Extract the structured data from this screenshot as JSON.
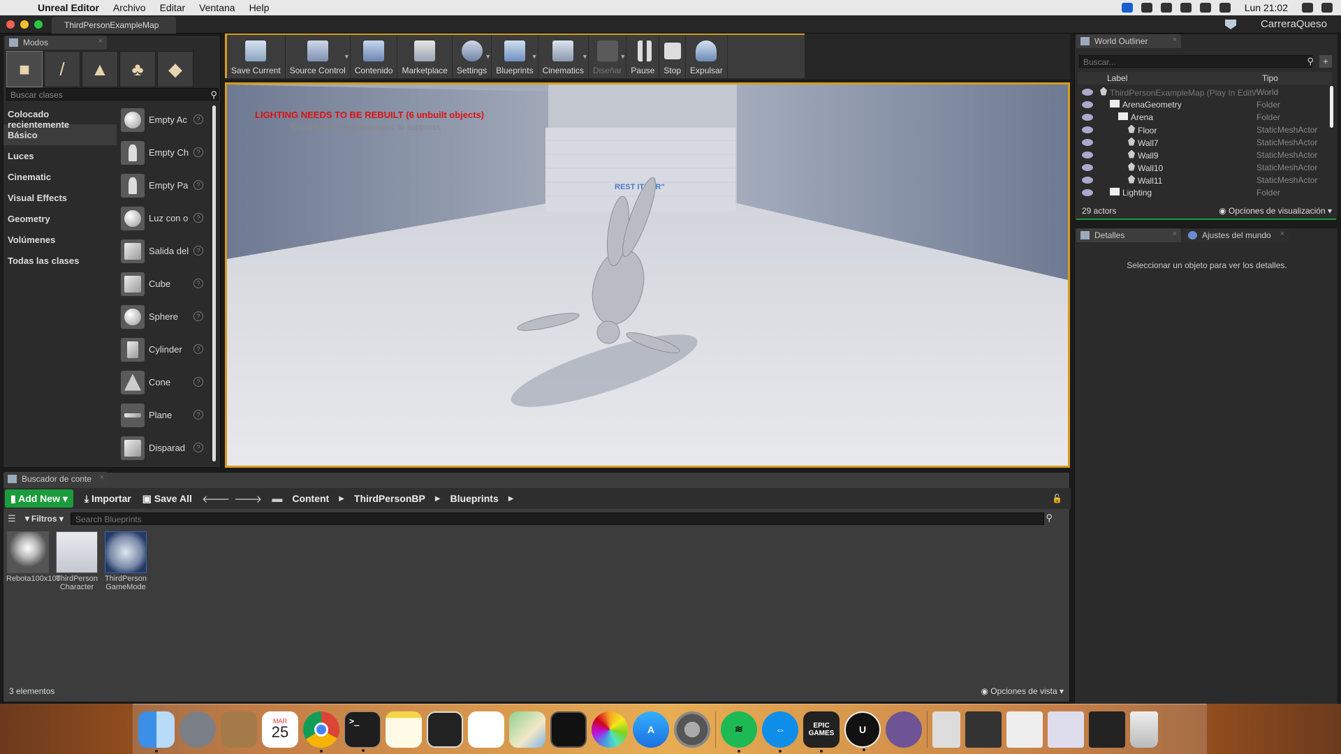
{
  "menubar": {
    "app_name": "Unreal Editor",
    "items": [
      "Archivo",
      "Editar",
      "Ventana",
      "Help"
    ],
    "clock": "Lun 21:02"
  },
  "window": {
    "tab_title": "ThirdPersonExampleMap",
    "project_name": "CarreraQueso"
  },
  "modes": {
    "tab_label": "Modos",
    "search_placeholder": "Buscar clases",
    "categories": [
      "Colocado recientemente",
      "Básico",
      "Luces",
      "Cinematic",
      "Visual Effects",
      "Geometry",
      "Volúmenes",
      "Todas las clases"
    ],
    "active_category": "Básico",
    "classes": [
      "Empty Ac",
      "Empty Ch",
      "Empty Pa",
      "Luz con o",
      "Salida del",
      "Cube",
      "Sphere",
      "Cylinder",
      "Cone",
      "Plane",
      "Disparad"
    ]
  },
  "toolbar": {
    "buttons": [
      {
        "label": "Save Current",
        "icon": "save-icon"
      },
      {
        "label": "Source Control",
        "icon": "source-control-icon"
      },
      {
        "label": "Contenido",
        "icon": "content-icon"
      },
      {
        "label": "Marketplace",
        "icon": "marketplace-icon"
      },
      {
        "label": "Settings",
        "icon": "settings-icon"
      },
      {
        "label": "Blueprints",
        "icon": "blueprints-icon"
      },
      {
        "label": "Cinematics",
        "icon": "cinematics-icon"
      },
      {
        "label": "Diseñar",
        "icon": "build-icon"
      },
      {
        "label": "Pause",
        "icon": "pause-icon"
      },
      {
        "label": "Stop",
        "icon": "stop-icon"
      },
      {
        "label": "Expulsar",
        "icon": "eject-icon"
      }
    ]
  },
  "viewport": {
    "lighting_message": "LIGHTING NEEDS TO BE REBUILT (6 unbuilt objects)",
    "suppress_message": "'DisableAllScreenMessages' to suppress",
    "wall_text": "REST      ITH \"R\""
  },
  "outliner": {
    "tab_label": "World Outliner",
    "search_placeholder": "Buscar...",
    "col_label": "Label",
    "col_type": "Tipo",
    "rows": [
      {
        "name": "ThirdPersonExampleMap (Play In EditWorld",
        "type": "World",
        "indent": 0
      },
      {
        "name": "ArenaGeometry",
        "type": "Folder",
        "indent": 1
      },
      {
        "name": "Arena",
        "type": "Folder",
        "indent": 2
      },
      {
        "name": "Floor",
        "type": "StaticMeshActor",
        "indent": 3
      },
      {
        "name": "Wall7",
        "type": "StaticMeshActor",
        "indent": 3
      },
      {
        "name": "Wall9",
        "type": "StaticMeshActor",
        "indent": 3
      },
      {
        "name": "Wall10",
        "type": "StaticMeshActor",
        "indent": 3
      },
      {
        "name": "Wall11",
        "type": "StaticMeshActor",
        "indent": 3
      },
      {
        "name": "Lighting",
        "type": "Folder",
        "indent": 1
      }
    ],
    "actor_count": "29 actors",
    "view_options": "Opciones de visualización"
  },
  "details": {
    "tab_label": "Detalles",
    "world_tab_label": "Ajustes del mundo",
    "empty_message": "Seleccionar un objeto para ver los detalles."
  },
  "content_browser": {
    "tab_label": "Buscador de conte",
    "add_new": "Add New",
    "import": "Importar",
    "save_all": "Save All",
    "breadcrumbs": [
      "Content",
      "ThirdPersonBP",
      "Blueprints"
    ],
    "filters": "Filtros",
    "search_placeholder": "Search Blueprints",
    "assets": [
      {
        "label": "Rebota100x100"
      },
      {
        "label": "ThirdPerson Character"
      },
      {
        "label": "ThirdPerson GameMode"
      }
    ],
    "count": "3 elementos",
    "view_options": "Opciones de vista"
  },
  "dock": {
    "calendar_month": "MAR",
    "calendar_day": "25",
    "epic_label": "EPIC GAMES"
  }
}
